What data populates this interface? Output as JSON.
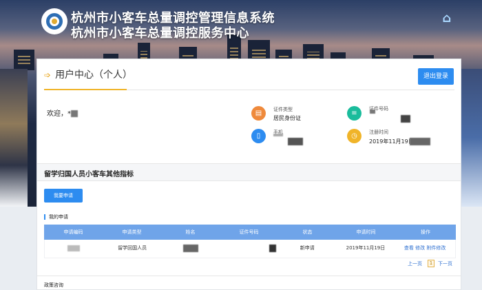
{
  "header": {
    "title_line1": "杭州市小客车总量调控管理信息系统",
    "title_line2": "杭州市小客车总量调控服务中心"
  },
  "user_center": {
    "title": "用户中心（个人）",
    "logout_label": "退出登录",
    "welcome": "欢迎，*"
  },
  "profile": {
    "id_type_label": "证件类型",
    "id_type_value": "居民身份证",
    "id_number_label": "证件号码",
    "phone_label": "手机",
    "reg_time_label": "注册时间",
    "reg_time_value": "2019年11月19日"
  },
  "section": {
    "title": "留学归国人员小客车其他指标",
    "apply_button": "我要申请",
    "my_apps_label": "我的申请"
  },
  "table": {
    "headers": [
      "申请编码",
      "申请类型",
      "姓名",
      "证件号码",
      "状态",
      "申请时间",
      "操作"
    ],
    "row": {
      "type": "留学回国人员",
      "status": "新申请",
      "time": "2019年11月19日",
      "action_view": "查看",
      "action_edit": "修改",
      "action_attach": "附件修改"
    }
  },
  "pager": {
    "prev": "上一页",
    "current": "1",
    "next": "下一页"
  },
  "footer": {
    "policy": "政策咨询"
  },
  "colors": {
    "primary": "#2d8cf0",
    "table_header": "#6fa4e9",
    "accent": "#f0b429"
  }
}
